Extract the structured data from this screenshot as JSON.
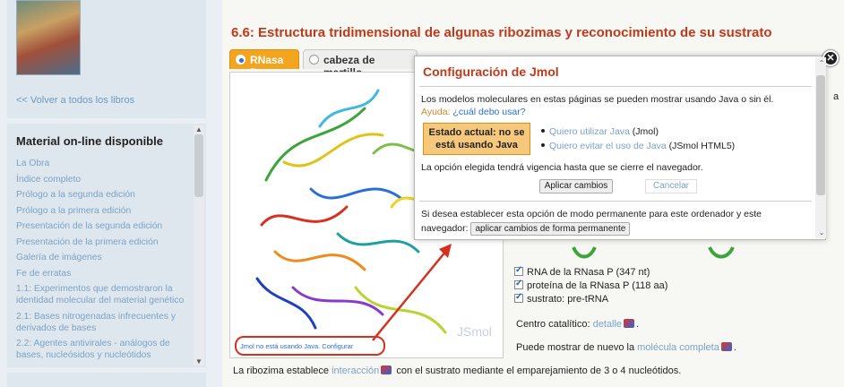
{
  "sidebar": {
    "back_link": "<< Volver a todos los libros",
    "menu_title": "Material on-line disponible",
    "items": [
      "La Obra",
      "Índice completo",
      "Prólogo a la segunda edición",
      "Prólogo a la primera edición",
      "Presentación de la segunda edición",
      "Presentación de la primera edición",
      "Galería de imágenes",
      "Fe de erratas",
      "1.1: Experimentos que demostraron la identidad molecular del material genético",
      "2.1: Bases nitrogenadas infrecuentes y derivados de bases",
      "2.2: Agentes antivirales - análogos de bases, nucleósidos y nucleótidos"
    ]
  },
  "main": {
    "title": "6.6: Estructura tridimensional de algunas ribozimas y reconocimiento de su sustrato",
    "tabs": [
      "RNasa P",
      "cabeza de martillo"
    ],
    "viewer": {
      "logo": "JSmol",
      "status_link": "Jmol no está usando Java. Configurar"
    },
    "checkboxes": [
      "RNA de la RNasa P (347 nt)",
      "proteína de la RNasa P (118 aa)",
      "sustrato: pre-tRNA"
    ],
    "catalytic_prefix": "Centro catalítico: ",
    "catalytic_link": "detalle",
    "show_prefix": "Puede mostrar de nuevo la ",
    "show_link": "molécula completa",
    "bottom_prefix": "La ribozima establece ",
    "bottom_link": "interacción",
    "bottom_suffix": " con el sustrato mediante el emparejamiento de 3 o 4 nucleótidos.",
    "side_fragment": "a"
  },
  "dialog": {
    "title": "Configuración de Jmol",
    "intro": "Los modelos moleculares en estas páginas se pueden mostrar usando Java o sin él.",
    "help_prefix": "Ayuda: ",
    "help_link": "¿cuál debo usar?",
    "state_line1": "Estado actual: no se",
    "state_line2": "está usando Java",
    "opt1_link": "Quiero utilizar Java",
    "opt1_suffix": " (Jmol)",
    "opt2_link": "Quiero evitar el uso de Java",
    "opt2_suffix": " (JSmol HTML5)",
    "validity": "La opción elegida tendrá vigencia hasta que se cierre el navegador.",
    "apply_button": "Aplicar cambios",
    "cancel_button": "Cancelar",
    "perm_text": "Si desea establecer esta opción de modo permanente para este ordenador y este navegador: ",
    "perm_button": "aplicar cambios de forma permanente",
    "close_icon": "close-icon"
  },
  "colors": {
    "title_red": "#c0391b",
    "tab_orange": "#f3a51f",
    "link_blue": "#7aa3c6",
    "annotation_red": "#d8301e"
  }
}
